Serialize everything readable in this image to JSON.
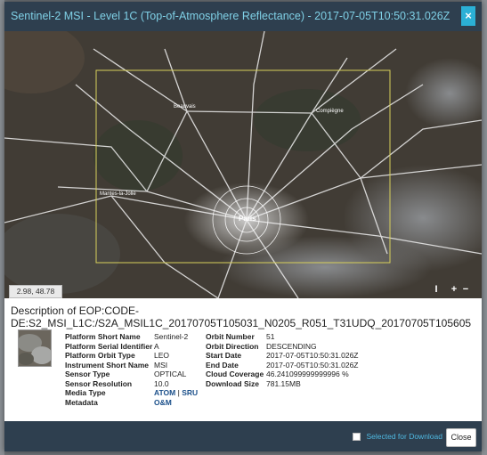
{
  "window": {
    "title": "Sentinel-2 MSI - Level 1C (Top-of-Atmosphere Reflectance) - 2017-07-05T10:50:31.026Z",
    "close_glyph": "×"
  },
  "map": {
    "coordinates": "2.98, 48.78",
    "center_label": "Paris",
    "city_labels": [
      "Beauvais",
      "Compiègne",
      "Mantes-la-Jolie"
    ],
    "controls": {
      "extent": "I",
      "zoom_in": "+",
      "zoom_out": "−"
    },
    "footprint_color": "#d8d05a"
  },
  "description": {
    "title": "Description of EOP:CODE-DE:S2_MSI_L1C:/S2A_MSIL1C_20170705T105031_N0205_R051_T31UDQ_20170705T105605",
    "left_keys": [
      "Platform Short Name",
      "Platform Serial Identifier",
      "Platform Orbit Type",
      "Instrument Short Name",
      "Sensor Type",
      "Sensor Resolution",
      "Media Type",
      "Metadata"
    ],
    "left_values": [
      "Sentinel-2",
      "A",
      "LEO",
      "MSI",
      "OPTICAL",
      "10.0"
    ],
    "media_atom": "ATOM",
    "media_sep": " | ",
    "media_sru": "SRU",
    "metadata_link": "O&M",
    "right_keys": [
      "Orbit Number",
      "Orbit Direction",
      "Start Date",
      "End Date",
      "Cloud Coverage",
      "Download Size"
    ],
    "right_values": [
      "51",
      "DESCENDING",
      "2017-07-05T10:50:31.026Z",
      "2017-07-05T10:50:31.026Z",
      "46.241099999999996 %",
      "781.15MB"
    ]
  },
  "footer": {
    "selected_label": "Selected for Download",
    "close_label": "Close"
  },
  "colors": {
    "header_bg": "#2e3f4f",
    "title_color": "#7fd0e6",
    "accent": "#2bb0d6"
  }
}
